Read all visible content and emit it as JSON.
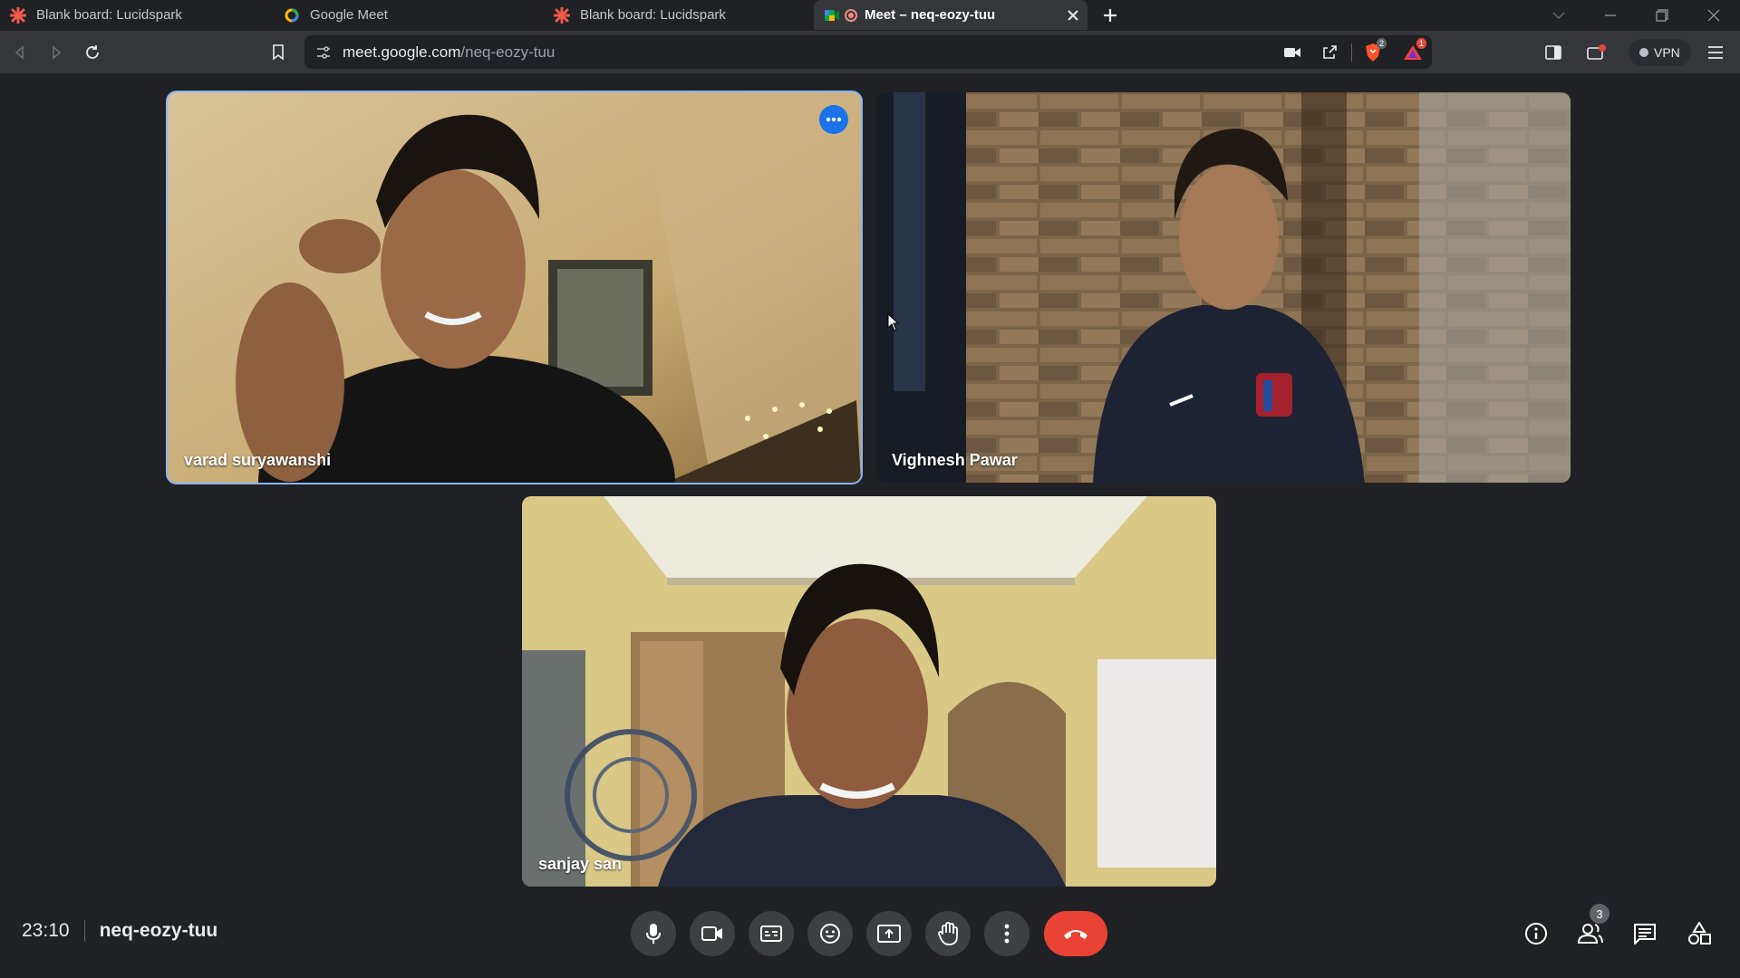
{
  "browser": {
    "tabs": [
      {
        "title": "Blank board: Lucidspark",
        "icon": "lucidspark-icon",
        "active": false
      },
      {
        "title": "Google Meet",
        "icon": "google-meet-icon",
        "active": false
      },
      {
        "title": "Blank board: Lucidspark",
        "icon": "lucidspark-icon",
        "active": false
      },
      {
        "title": "Meet – neq-eozy-tuu",
        "icon": "google-meet-icon",
        "active": true
      }
    ],
    "url": {
      "host": "meet.google.com",
      "path": "/neq-eozy-tuu"
    },
    "brave_badge": "2",
    "alerts_badge": "1",
    "vpn_label": "VPN"
  },
  "participants": [
    {
      "name": "varad suryawanshi",
      "speaking": true
    },
    {
      "name": "Vighnesh Pawar",
      "speaking": false
    },
    {
      "name": "sanjay san",
      "speaking": false
    }
  ],
  "meeting": {
    "time": "23:10",
    "code": "neq-eozy-tuu",
    "participant_count": "3"
  },
  "colors": {
    "background": "#202124",
    "speaking_outline": "#8ab4f8",
    "hangup": "#ea4335",
    "control": "#3c4043"
  }
}
